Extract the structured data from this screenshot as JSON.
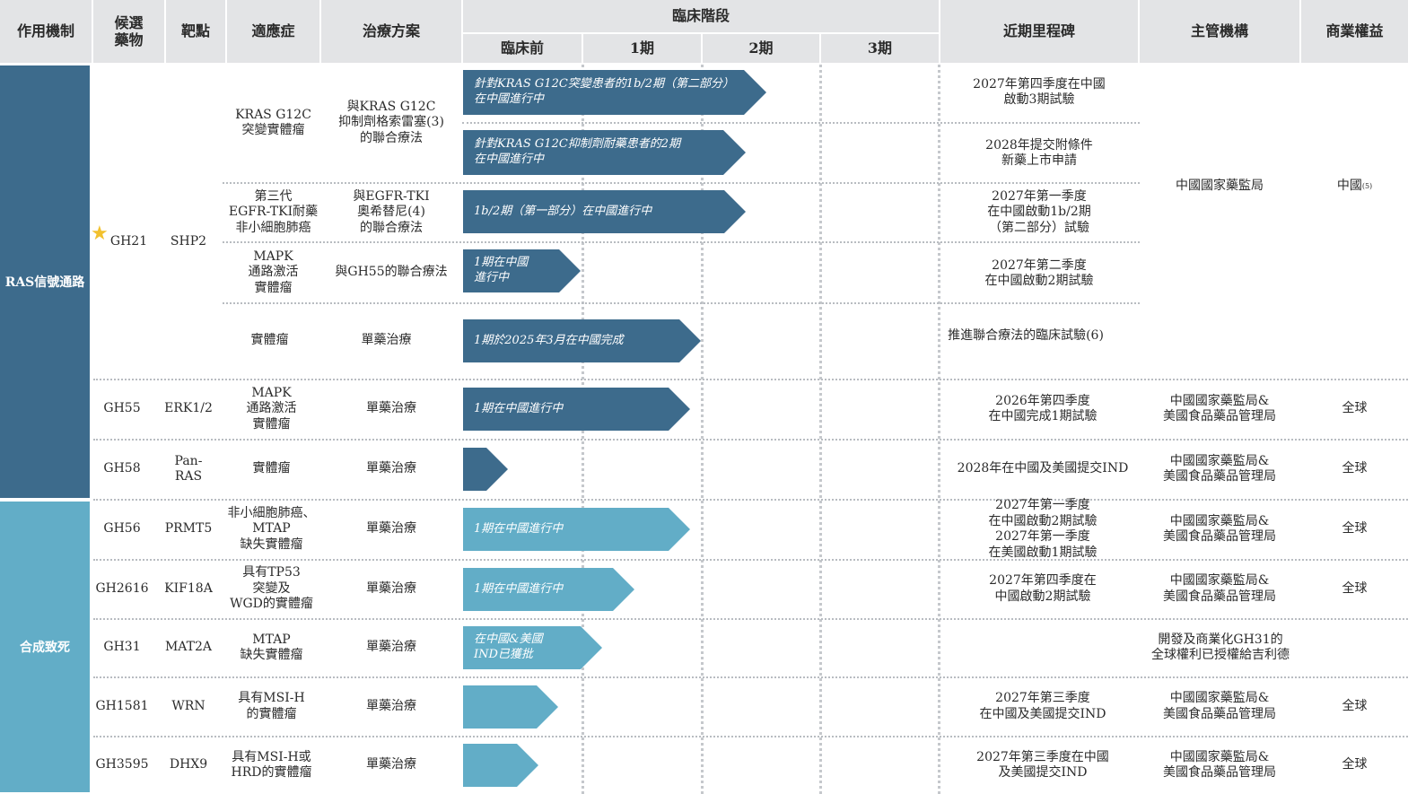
{
  "headers": {
    "mechanism": "作用機制",
    "candidate": "候選\n藥物",
    "target": "靶點",
    "indication": "適應症",
    "regimen": "治療方案",
    "clinical_stage": "臨床階段",
    "preclinical": "臨床前",
    "phase1": "1期",
    "phase2": "2期",
    "phase3": "3期",
    "milestone": "近期里程碑",
    "authority": "主管機構",
    "rights": "商業權益"
  },
  "mechanisms": [
    {
      "label": "RAS信號通路",
      "color": "#3d6b8c"
    },
    {
      "label": "合成致死",
      "color": "#62adc7"
    }
  ],
  "gh21": {
    "candidate": "GH21",
    "target": "SHP2",
    "authority": "中國國家藥監局",
    "rights": "中國",
    "rights_note": "(5)",
    "star_icon": "star-icon"
  },
  "rows": [
    {
      "indication": "KRAS G12C\n突變實體瘤",
      "regimen": "與KRAS G12C\n抑制劑格索雷塞(3)\n的聯合療法"
    },
    {
      "bar": "針對KRAS G12C突變患者的1b/2期（第二部分）\n在中國進行中",
      "milestone": "2027年第四季度在中國\n啟動3期試驗"
    },
    {
      "bar": "針對KRAS G12C抑制劑耐藥患者的2期\n在中國進行中",
      "milestone": "2028年提交附條件\n新藥上市申請"
    },
    {
      "indication": "第三代\nEGFR-TKI耐藥\n非小細胞肺癌",
      "regimen": "與EGFR-TKI\n奧希替尼(4)\n的聯合療法",
      "bar": "1b/2期（第一部分）在中國進行中",
      "milestone": "2027年第一季度\n在中國啟動1b/2期\n（第二部分）試驗"
    },
    {
      "indication": "MAPK\n通路激活\n實體瘤",
      "regimen": "與GH55的聯合療法",
      "bar": "1期在中國\n進行中",
      "milestone": "2027年第二季度\n在中國啟動2期試驗"
    },
    {
      "indication": "實體瘤",
      "regimen": "單藥治療",
      "bar": "1期於2025年3月在中國完成",
      "milestone": "推進聯合療法的臨床試驗(6)"
    },
    {
      "candidate": "GH55",
      "target": "ERK1/2",
      "indication": "MAPK\n通路激活\n實體瘤",
      "regimen": "單藥治療",
      "bar": "1期在中國進行中",
      "milestone": "2026年第四季度\n在中國完成1期試驗",
      "authority": "中國國家藥監局&\n美國食品藥品管理局",
      "rights": "全球"
    },
    {
      "candidate": "GH58",
      "target": "Pan-RAS",
      "indication": "實體瘤",
      "regimen": "單藥治療",
      "bar": "",
      "milestone": "2028年在中國及美國提交IND",
      "authority": "中國國家藥監局&\n美國食品藥品管理局",
      "rights": "全球"
    },
    {
      "candidate": "GH56",
      "target": "PRMT5",
      "indication": "非小細胞肺癌、\nMTAP\n缺失實體瘤",
      "regimen": "單藥治療",
      "bar": "1期在中國進行中",
      "milestone": "2027年第一季度\n在中國啟動2期試驗\n2027年第一季度\n在美國啟動1期試驗",
      "authority": "中國國家藥監局&\n美國食品藥品管理局",
      "rights": "全球"
    },
    {
      "candidate": "GH2616",
      "target": "KIF18A",
      "indication": "具有TP53\n突變及\nWGD的實體瘤",
      "regimen": "單藥治療",
      "bar": "1期在中國進行中",
      "milestone": "2027年第四季度在\n中國啟動2期試驗",
      "authority": "中國國家藥監局&\n美國食品藥品管理局",
      "rights": "全球"
    },
    {
      "candidate": "GH31",
      "target": "MAT2A",
      "indication": "MTAP\n缺失實體瘤",
      "regimen": "單藥治療",
      "bar": "在中國&美國\nIND已獲批",
      "milestone": "",
      "authority": "開發及商業化GH31的\n全球權利已授權給吉利德",
      "rights": ""
    },
    {
      "candidate": "GH1581",
      "target": "WRN",
      "indication": "具有MSI-H\n的實體瘤",
      "regimen": "單藥治療",
      "bar": "",
      "milestone": "2027年第三季度\n在中國及美國提交IND",
      "authority": "中國國家藥監局&\n美國食品藥品管理局",
      "rights": "全球"
    },
    {
      "candidate": "GH3595",
      "target": "DHX9",
      "indication": "具有MSI-H或\nHRD的實體瘤",
      "regimen": "單藥治療",
      "bar": "",
      "milestone": "2027年第三季度在中國\n及美國提交IND",
      "authority": "中國國家藥監局&\n美國食品藥品管理局",
      "rights": "全球"
    }
  ]
}
